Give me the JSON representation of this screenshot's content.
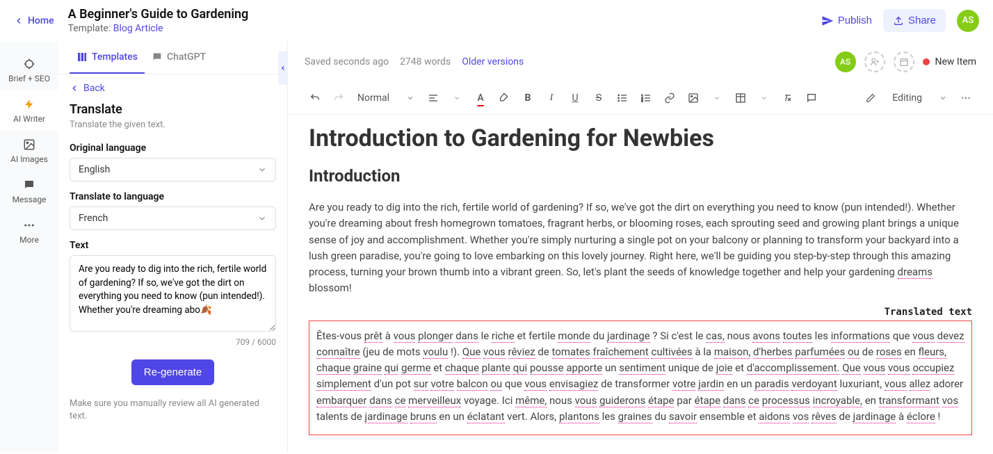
{
  "topbar": {
    "home_label": "Home",
    "doc_title": "A Beginner's Guide to Gardening",
    "template_prefix": "Template: ",
    "template_name": "Blog Article",
    "publish_label": "Publish",
    "share_label": "Share",
    "avatar_initials": "AS"
  },
  "nav": {
    "items": [
      {
        "label": "Brief + SEO"
      },
      {
        "label": "AI Writer"
      },
      {
        "label": "AI Images"
      },
      {
        "label": "Message"
      },
      {
        "label": "More"
      }
    ]
  },
  "panel": {
    "tabs": {
      "templates": "Templates",
      "chatgpt": "ChatGPT"
    },
    "back_label": "Back",
    "tool_title": "Translate",
    "tool_desc": "Translate the given text.",
    "orig_label": "Original language",
    "orig_value": "English",
    "to_label": "Translate to language",
    "to_value": "French",
    "text_label": "Text",
    "text_value": "Are you ready to dig into the rich, fertile world of gardening? If so, we've got the dirt on everything you need to know (pun intended!). Whether you're dreaming abo🍂",
    "char_count": "709 / 6000",
    "regen_label": "Re-generate",
    "warning": "Make sure you manually review all AI generated text."
  },
  "editor_header": {
    "saved": "Saved seconds ago",
    "wordcount": "2748 words",
    "older": "Older versions",
    "avatar": "AS",
    "new_item": "New Item"
  },
  "toolbar": {
    "style": "Normal",
    "mode": "Editing"
  },
  "content": {
    "h1": "Introduction to Gardening for Newbies",
    "h2": "Introduction",
    "para_pre": "Are you ready to dig into the rich, fertile world of gardening? If so, we've got the dirt on everything you need to know (pun intended!). Whether you're dreaming about fresh homegrown tomatoes, fragrant herbs, or blooming roses, each sprouting seed and growing plant brings a unique sense of joy and accomplishment. Whether you're simply nurturing a single pot on your balcony or planning to transform your backyard into a lush green paradise, you're going to love embarking on this lovely journey. Right here, we'll be guiding you step-by-step through this amazing process, turning your brown thumb into a vibrant green. So, let's plant the seeds of knowledge together and help your gardening ",
    "para_dotted": "dreams",
    "para_post": " blossom!",
    "trans_label": "Translated text",
    "translated": "Êtes-vous prêt à vous plonger dans le riche et fertile monde du jardinage ? Si c'est le cas, nous avons toutes les informations que vous devez connaître (jeu de mots voulu !). Que vous rêviez de tomates fraîchement cultivées à la maison, d'herbes parfumées ou de roses en fleurs, chaque graine qui germe et chaque plante qui pousse apporte un sentiment unique de joie et d'accomplissement. Que vous vous occupiez simplement d'un pot sur votre balcon ou que vous envisagiez de transformer votre jardin en un paradis verdoyant luxuriant, vous allez adorer embarquer dans ce merveilleux voyage. Ici même, nous vous guiderons étape par étape dans ce processus incroyable, en transformant vos talents de jardinage bruns en un éclatant vert. Alors, plantons les graines du savoir ensemble et aidons vos rêves de jardinage à éclore !"
  }
}
